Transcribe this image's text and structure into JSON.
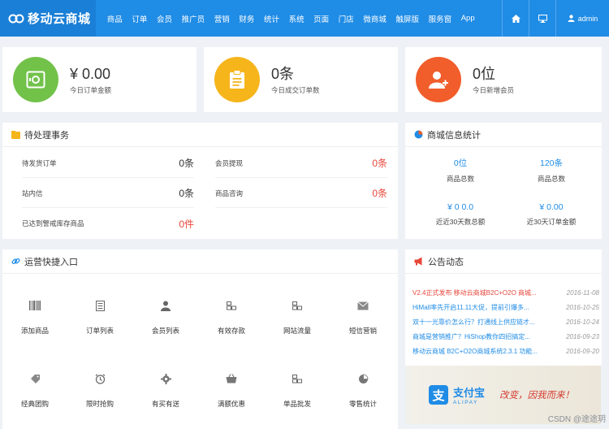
{
  "brand": {
    "name": "移动云商城"
  },
  "nav": {
    "items": [
      "商品",
      "订单",
      "会员",
      "推广员",
      "营销",
      "财务",
      "统计",
      "系统",
      "页面",
      "门店",
      "微商城",
      "触屏版",
      "服务窗",
      "App"
    ],
    "user": "admin"
  },
  "stats": [
    {
      "value": "¥ 0.00",
      "label": "今日订单金额"
    },
    {
      "value": "0条",
      "label": "今日成交订单数"
    },
    {
      "value": "0位",
      "label": "今日新增会员"
    }
  ],
  "todo": {
    "title": "待处理事务",
    "rows": [
      {
        "label": "待发货订单",
        "value": "0条"
      },
      {
        "label": "会员提现",
        "value": "0条"
      },
      {
        "label": "站内信",
        "value": "0条"
      },
      {
        "label": "商品咨询",
        "value": "0条"
      },
      {
        "label": "已达到警戒库存商品",
        "value": "0件"
      }
    ]
  },
  "shop": {
    "title": "商城信息统计",
    "items": [
      {
        "value": "0位",
        "label": "商品总数"
      },
      {
        "value": "120条",
        "label": "商品总数"
      },
      {
        "value": "¥ 0 0.0",
        "label": "近近30天数总额"
      },
      {
        "value": "¥ 0.00",
        "label": "近30天订单金额"
      }
    ]
  },
  "quick": {
    "title": "运营快捷入口",
    "items": [
      "添加商品",
      "订单列表",
      "会员列表",
      "有效存款",
      "网站流量",
      "短信营销",
      "经典团购",
      "限时抢购",
      "有买有送",
      "满额优惠",
      "单品批发",
      "零售统计"
    ]
  },
  "notice": {
    "title": "公告动态",
    "items": [
      {
        "text": "V2.4正式发布 移动云商城B2C+O2O 商城...",
        "date": "2016-11-08"
      },
      {
        "text": "HiMall率先开启11.11大促，提前引爆多...",
        "date": "2016-10-25"
      },
      {
        "text": "双十一光靠价怎么行？打通线上供应链才...",
        "date": "2016-10-24"
      },
      {
        "text": "商城是营销推广？HiShop教你四招搞定...",
        "date": "2016-09-23"
      },
      {
        "text": "移动云商城 B2C+O2O商城系统2.3.1 功能...",
        "date": "2016-09-20"
      }
    ]
  },
  "banner": {
    "name": "支付宝",
    "sub": "ALIPAY",
    "slogan": "改变，因我而来！"
  },
  "watermark": "CSDN @途途玥",
  "colors": {
    "primary": "#1f8ce6",
    "green": "#72c24a",
    "yellow": "#f5b51b",
    "orange": "#f15d2b",
    "red": "#e7463a"
  }
}
